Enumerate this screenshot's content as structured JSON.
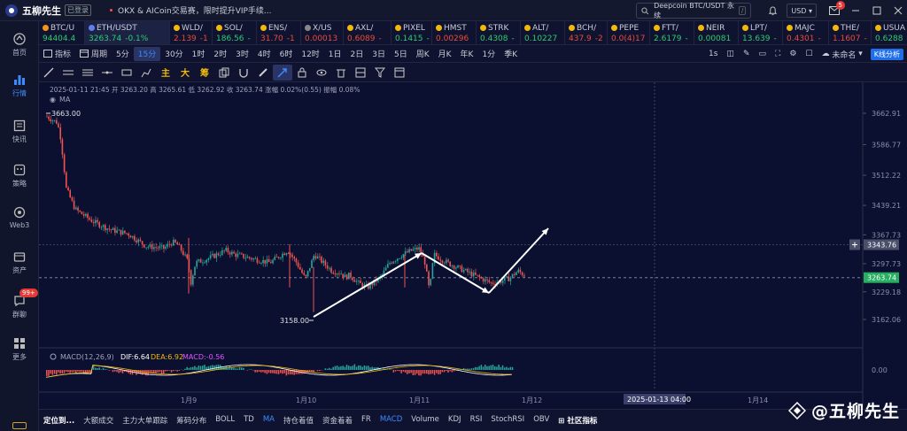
{
  "app": {
    "brand": "五柳先生",
    "login_tag": "已登录",
    "news": "OKX & AICoin交易赛，限时提升VIP手续..."
  },
  "top": {
    "search_placeholder": "Deepcoin BTC/USDT 永续",
    "search_kbd": "/",
    "currency": "USD",
    "notif_count": "5"
  },
  "sidebar": [
    {
      "label": "首页",
      "icon": "home-icon"
    },
    {
      "label": "行情",
      "icon": "chart-icon",
      "active": true
    },
    {
      "label": "快讯",
      "icon": "news-icon"
    },
    {
      "label": "策略",
      "icon": "strategy-icon"
    },
    {
      "label": "Web3",
      "icon": "web3-icon"
    },
    {
      "label": "资产",
      "icon": "wallet-icon"
    },
    {
      "label": "群聊",
      "icon": "chat-icon",
      "badge": "99+"
    },
    {
      "label": "更多",
      "icon": "more-icon"
    }
  ],
  "tickers": [
    {
      "name": "BTC/U",
      "price": "94404.4",
      "dir": "up",
      "color": "#f7931a"
    },
    {
      "name": "ETH/USDT",
      "price": "3263.74",
      "change": "-0.1%",
      "dir": "up",
      "color": "#627eea",
      "active": true
    },
    {
      "name": "WLD/",
      "price": "2.139",
      "change": "-1",
      "dir": "dn",
      "color": "#f0b90b"
    },
    {
      "name": "SOL/",
      "price": "186.56",
      "change": "-",
      "dir": "up",
      "color": "#f0b90b"
    },
    {
      "name": "ENS/",
      "price": "31.70",
      "change": "-1",
      "dir": "dn",
      "color": "#f0b90b"
    },
    {
      "name": "X/US",
      "price": "0.00013",
      "dir": "dn",
      "color": "#888888"
    },
    {
      "name": "AXL/",
      "price": "0.6089",
      "change": "-",
      "dir": "dn",
      "color": "#f0b90b"
    },
    {
      "name": "PIXEL",
      "price": "0.1415",
      "change": "-",
      "dir": "up",
      "color": "#f0b90b"
    },
    {
      "name": "HMST",
      "price": "0.00296",
      "dir": "dn",
      "color": "#f0b90b"
    },
    {
      "name": "STRK",
      "price": "0.4308",
      "change": "-",
      "dir": "up",
      "color": "#f0b90b"
    },
    {
      "name": "ALT/",
      "price": "0.10227",
      "dir": "up",
      "color": "#f0b90b"
    },
    {
      "name": "BCH/",
      "price": "437.9",
      "change": "-2",
      "dir": "dn",
      "color": "#f0b90b"
    },
    {
      "name": "PEPE",
      "price": "0.0(4)17",
      "dir": "dn",
      "color": "#f0b90b"
    },
    {
      "name": "FTT/",
      "price": "2.6179",
      "change": "-",
      "dir": "up",
      "color": "#f0b90b"
    },
    {
      "name": "NEIR",
      "price": "0.00081",
      "dir": "up",
      "color": "#f0b90b"
    },
    {
      "name": "LPT/",
      "price": "13.639",
      "change": "-",
      "dir": "up",
      "color": "#f0b90b"
    },
    {
      "name": "MAJC",
      "price": "0.4301",
      "change": "-",
      "dir": "dn",
      "color": "#f0b90b"
    },
    {
      "name": "THE/",
      "price": "1.1607",
      "change": "-",
      "dir": "dn",
      "color": "#f0b90b"
    },
    {
      "name": "USUA",
      "price": "0.6288",
      "change": "-",
      "dir": "up",
      "color": "#f0b90b"
    }
  ],
  "toolbar1": {
    "indicator": "指标",
    "period": "周期",
    "timeframes": [
      "5分",
      "15分",
      "30分",
      "1时",
      "2时",
      "3时",
      "4时",
      "6时",
      "12时",
      "1日",
      "2日",
      "3日",
      "5日",
      "周K",
      "月K",
      "年K",
      "1分",
      "季K"
    ],
    "active_tf": "15分",
    "right": {
      "interval": "1s",
      "unnamed": "未命名",
      "kline_analysis": "K线分析"
    }
  },
  "toolbar2": {
    "cn_tools": [
      "主",
      "大",
      "筹"
    ]
  },
  "chart_info": {
    "line1": "2025-01-11 21:45  开 3263.20  高 3265.61  低 3262.92  收 3263.74  涨幅 0.02%(0.55)  振幅 0.08%",
    "ma": "MA"
  },
  "chart_data": {
    "type": "candlestick",
    "y_ticks": [
      "3662.91",
      "3586.77",
      "3512.22",
      "3439.21",
      "3367.73",
      "3297.73",
      "3229.18",
      "3162.06"
    ],
    "x_ticks": [
      "1月9",
      "1月10",
      "1月11",
      "1月12",
      "1月14"
    ],
    "last_price": "3263.74",
    "crosshair_price": "3343.76",
    "crosshair_time": "2025-01-13 04:00",
    "high_label": "3663.00",
    "low_label": "3158.00",
    "macd": {
      "label": "MACD(12,26,9)",
      "dif": "DIF:6.64",
      "dea": "DEA:6.92",
      "macd": "MACD:-0.56",
      "zero": "0.00"
    },
    "arrows": "white annotation arrows: low → up → down → up"
  },
  "bottom": {
    "locate": "定位到...",
    "indicators": [
      "大额成交",
      "主力大单跟踪",
      "筹码分布",
      "BOLL",
      "TD",
      "MA",
      "持仓着值",
      "资金着着",
      "FR",
      "MACD",
      "Volume",
      "KDJ",
      "RSI",
      "StochRSI",
      "OBV"
    ],
    "active": [
      "MA",
      "MACD"
    ],
    "community": "社区指标"
  },
  "watermark": "@五柳先生"
}
